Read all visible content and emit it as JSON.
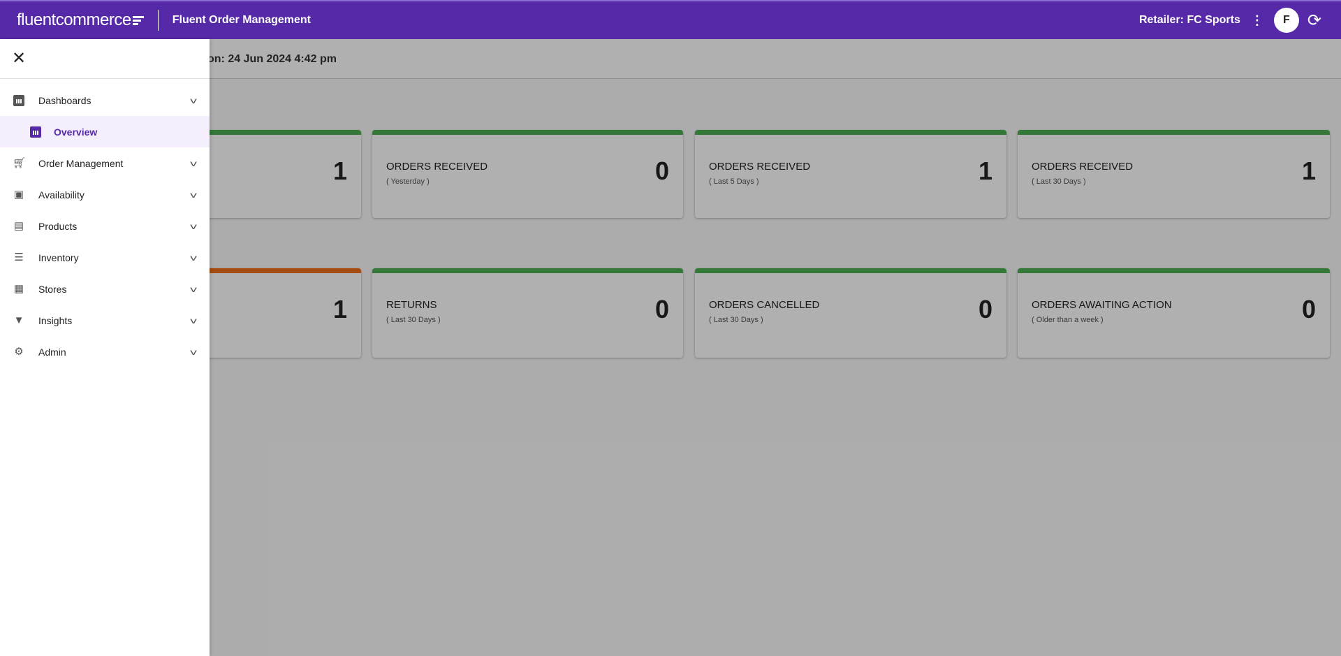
{
  "header": {
    "logo_text": "fluentcommerce",
    "app_title": "Fluent Order Management",
    "retailer": "Retailer: FC Sports",
    "avatar_initial": "F",
    "brand_color": "#5529a8"
  },
  "subheader": {
    "last_updated": "on: 24 Jun 2024 4:42 pm"
  },
  "cards_row1": [
    {
      "value": "1",
      "bar_color": "#4caf50"
    },
    {
      "title": "ORDERS RECEIVED",
      "subtitle": "( Yesterday )",
      "value": "0",
      "bar_color": "#4caf50"
    },
    {
      "title": "ORDERS RECEIVED",
      "subtitle": "( Last 5 Days )",
      "value": "1",
      "bar_color": "#4caf50"
    },
    {
      "title": "ORDERS RECEIVED",
      "subtitle": "( Last 30 Days )",
      "value": "1",
      "bar_color": "#4caf50"
    }
  ],
  "cards_row2": [
    {
      "value": "1",
      "bar_color": "#f26c16"
    },
    {
      "title": "RETURNS",
      "subtitle": "( Last 30 Days )",
      "value": "0",
      "bar_color": "#4caf50"
    },
    {
      "title": "ORDERS CANCELLED",
      "subtitle": "( Last 30 Days )",
      "value": "0",
      "bar_color": "#4caf50"
    },
    {
      "title": "ORDERS AWAITING ACTION",
      "subtitle": "( Older than a week )",
      "value": "0",
      "bar_color": "#4caf50"
    }
  ],
  "sidebar": {
    "items": [
      {
        "label": "Dashboards",
        "icon": "bar-chart-icon"
      },
      {
        "label": "Overview",
        "icon": "bar-chart-icon",
        "active": true
      },
      {
        "label": "Order Management",
        "icon": "cart-icon"
      },
      {
        "label": "Availability",
        "icon": "briefcase-play-icon"
      },
      {
        "label": "Products",
        "icon": "web-icon"
      },
      {
        "label": "Inventory",
        "icon": "list-icon"
      },
      {
        "label": "Stores",
        "icon": "building-icon"
      },
      {
        "label": "Insights",
        "icon": "lightbulb-icon"
      },
      {
        "label": "Admin",
        "icon": "gear-icon"
      }
    ]
  }
}
